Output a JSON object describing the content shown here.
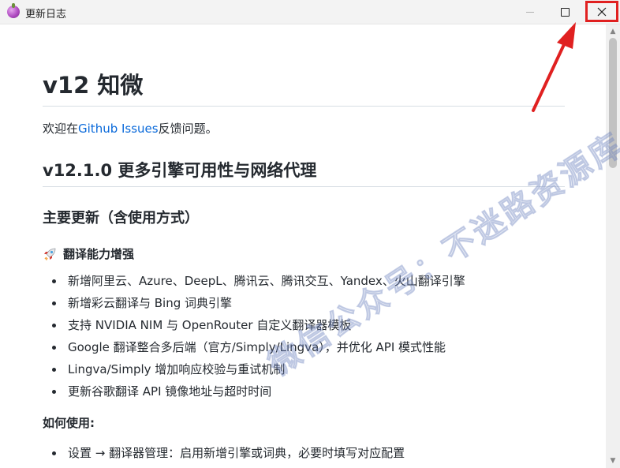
{
  "window": {
    "title": "更新日志",
    "controls": {
      "minimize_icon": "minimize-icon",
      "maximize_icon": "maximize-icon",
      "close_icon": "close-icon"
    }
  },
  "doc": {
    "heading": "v12 知微",
    "intro_before": "欢迎在",
    "intro_link": "Github Issues",
    "intro_after": "反馈问题。",
    "section_title": "v12.1.0 更多引擎可用性与网络代理",
    "subsection_title": "主要更新（含使用方式）",
    "feature_group": {
      "icon": "rocket-icon",
      "title": "翻译能力增强",
      "items": [
        "新增阿里云、Azure、DeepL、腾讯云、腾讯交互、Yandex、火山翻译引擎",
        "新增彩云翻译与 Bing 词典引擎",
        "支持 NVIDIA NIM 与 OpenRouter 自定义翻译器模板",
        "Google 翻译整合多后端（官方/Simply/Lingva），并优化 API 模式性能",
        "Lingva/Simply 增加响应校验与重试机制",
        "更新谷歌翻译 API 镜像地址与超时时间"
      ]
    },
    "howto_title": "如何使用:",
    "howto_items": [
      "设置 → 翻译器管理：启用新增引擎或词典，必要时填写对应配置"
    ]
  },
  "watermark": "微信公众号：不迷路资源库",
  "colors": {
    "link": "#0969da",
    "annotation": "#e02020",
    "text": "#24292f"
  }
}
